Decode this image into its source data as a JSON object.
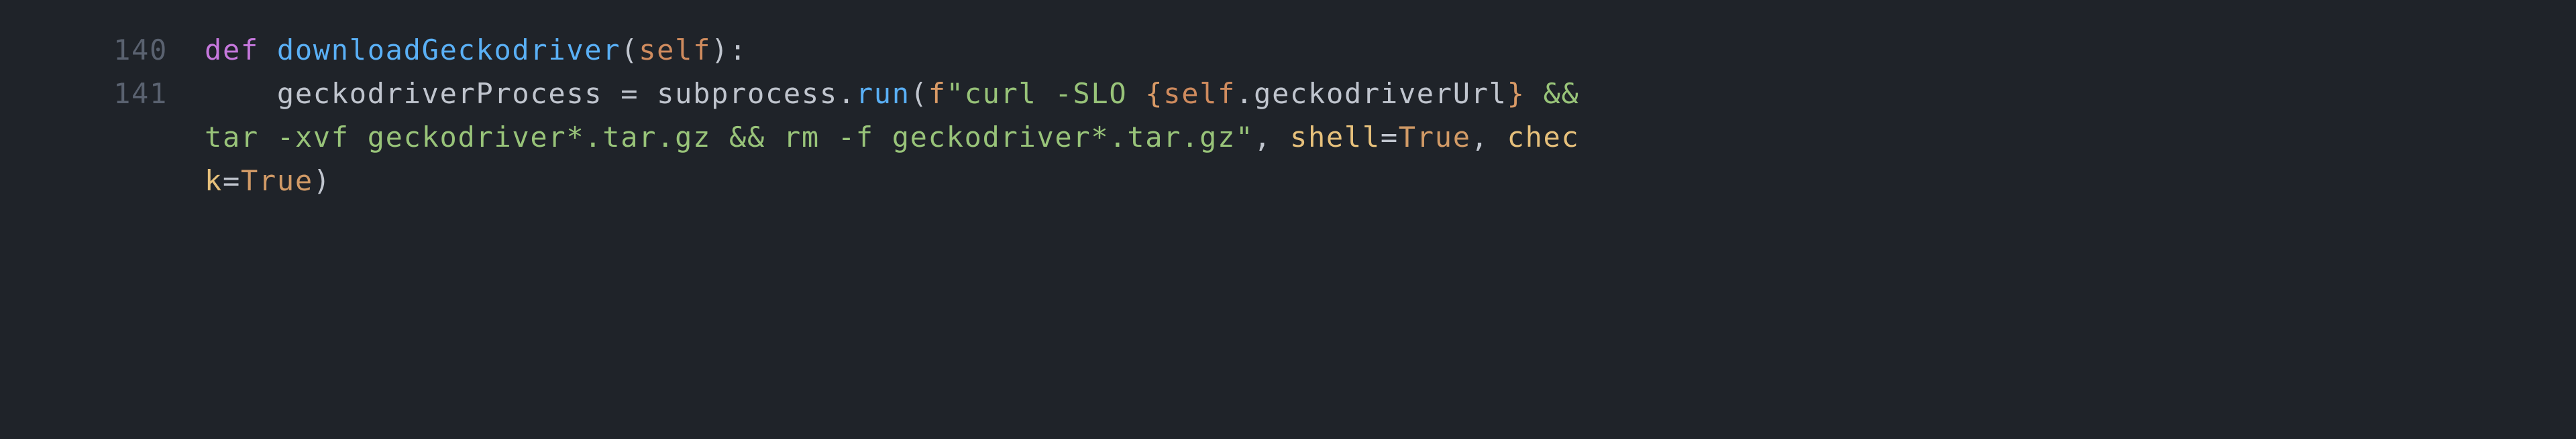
{
  "editor": {
    "lines": [
      {
        "number": "140",
        "indent": "",
        "segments": {
          "kw_def": "def",
          "sp1": " ",
          "fn_name": "downloadGeckodriver",
          "lparen": "(",
          "self": "self",
          "rparen_colon": "):"
        }
      },
      {
        "number": "141",
        "indent": "    ",
        "segments": {
          "var": "geckodriverProcess",
          "sp1": " ",
          "assign": "=",
          "sp2": " ",
          "mod": "subprocess",
          "dot": ".",
          "call": "run",
          "lparen": "(",
          "fprefix": "f",
          "str_open": "\"curl -SLO ",
          "interp_open": "{",
          "self": "self",
          "dot2": ".",
          "attr": "geckodriverUrl",
          "interp_close": "}",
          "str_after": " && "
        }
      },
      {
        "number": "",
        "indent": "",
        "segments": {
          "str_cont": "tar -xvf geckodriver*.tar.gz && rm -f geckodriver*.tar.gz\"",
          "comma1": ",",
          "sp1": " ",
          "kwarg_shell": "shell",
          "eq1": "=",
          "true1": "True",
          "comma2": ",",
          "sp2": " ",
          "kwarg_chec": "chec"
        }
      },
      {
        "number": "",
        "indent": "",
        "segments": {
          "kwarg_k": "k",
          "eq2": "=",
          "true2": "True",
          "rparen": ")"
        }
      }
    ]
  }
}
